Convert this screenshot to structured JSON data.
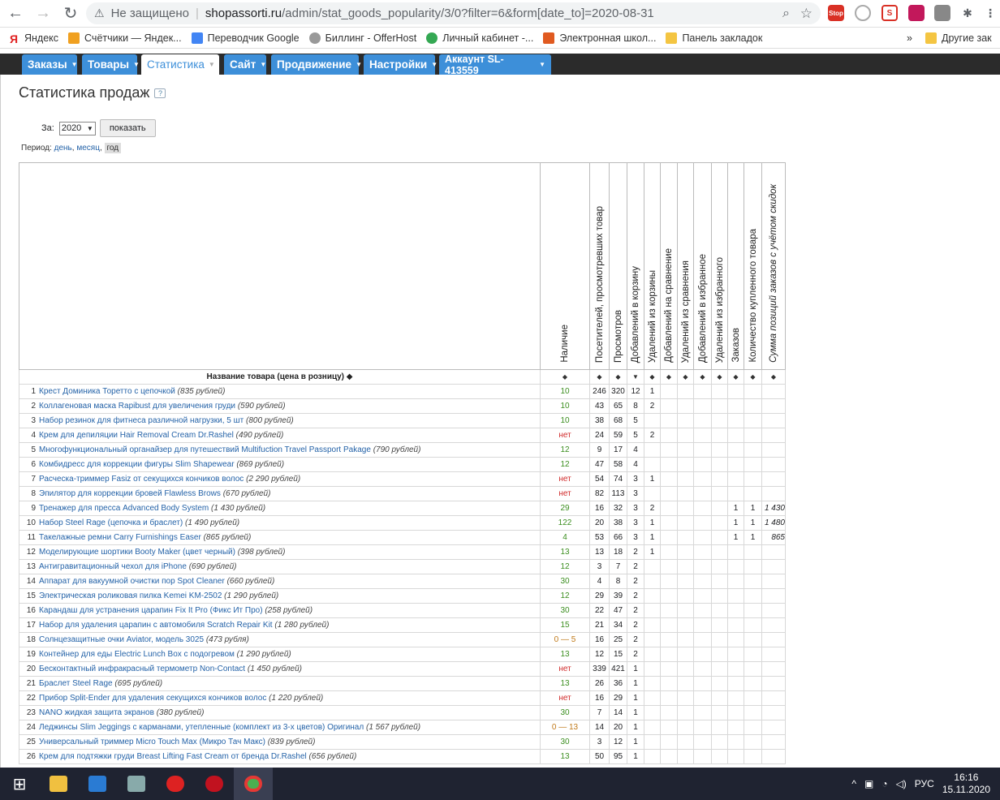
{
  "browser": {
    "security_text": "Не защищено",
    "url_host": "shopassorti.ru",
    "url_path": "/admin/stat_goods_popularity/3/0?filter=6&form[date_to]=2020-08-31"
  },
  "bookmarks": [
    {
      "label": "Яндекс",
      "color": "#e02020"
    },
    {
      "label": "Счётчики — Яндек...",
      "color": "#f0a020"
    },
    {
      "label": "Переводчик Google",
      "color": "#4285f4"
    },
    {
      "label": "Биллинг - OfferHost",
      "color": "#777777"
    },
    {
      "label": "Личный кабинет -...",
      "color": "#34a853"
    },
    {
      "label": "Электронная школ...",
      "color": "#e05a20"
    },
    {
      "label": "Панель закладок",
      "color": "#f4c542"
    }
  ],
  "bookmarks_other": "Другие зак",
  "admin_tabs": [
    "Заказы",
    "Товары",
    "Статистика",
    "Сайт",
    "Продвижение",
    "Настройки",
    "Аккаунт SL-413559"
  ],
  "page": {
    "title": "Статистика продаж",
    "help": "?",
    "for_label": "За:",
    "year": "2020",
    "show_button": "показать",
    "period_label": "Период:",
    "period_day": "день",
    "period_month": "месяц",
    "period_year": "год"
  },
  "table": {
    "name_header": "Название товара (цена в розницу) ◆",
    "columns": [
      "Наличие",
      "Посетителей, просмотревших товар",
      "Просмотров",
      "Добавлений в корзину",
      "Удалений из корзины",
      "Добавлений на сравнение",
      "Удалений из сравнения",
      "Добавлений в избранное",
      "Удалений из избранного",
      "Заказов",
      "Количество купленного товара",
      "Сумма позиций заказов с учётом скидок"
    ],
    "sort_marks": [
      "◆",
      "◆",
      "◆",
      "▼",
      "◆",
      "◆",
      "◆",
      "◆",
      "◆",
      "◆",
      "◆",
      "◆"
    ],
    "rows": [
      {
        "n": "1",
        "name": "Крест Доминика Торетто с цепочкой",
        "price": "(835 рублей)",
        "stock": "10",
        "st": "ok",
        "v": [
          "246",
          "320",
          "12",
          "1",
          "",
          "",
          "",
          "",
          "",
          "",
          ""
        ]
      },
      {
        "n": "2",
        "name": "Коллагеновая маска Rapibust для увеличения груди",
        "price": "(590 рублей)",
        "stock": "10",
        "st": "ok",
        "v": [
          "43",
          "65",
          "8",
          "2",
          "",
          "",
          "",
          "",
          "",
          "",
          ""
        ]
      },
      {
        "n": "3",
        "name": "Набор резинок для фитнеса различной нагрузки, 5 шт",
        "price": "(800 рублей)",
        "stock": "10",
        "st": "ok",
        "v": [
          "38",
          "68",
          "5",
          "",
          "",
          "",
          "",
          "",
          "",
          "",
          ""
        ]
      },
      {
        "n": "4",
        "name": "Крем для депиляции Hair Removal Cream Dr.Rashel",
        "price": "(490 рублей)",
        "stock": "нет",
        "st": "no",
        "v": [
          "24",
          "59",
          "5",
          "2",
          "",
          "",
          "",
          "",
          "",
          "",
          ""
        ]
      },
      {
        "n": "5",
        "name": "Многофункциональный органайзер для путешествий Multifuction Travel Passport Pakage",
        "price": "(790 рублей)",
        "stock": "12",
        "st": "ok",
        "v": [
          "9",
          "17",
          "4",
          "",
          "",
          "",
          "",
          "",
          "",
          "",
          ""
        ]
      },
      {
        "n": "6",
        "name": "Комбидресс для коррекции фигуры Slim Shapewear",
        "price": "(869 рублей)",
        "stock": "12",
        "st": "ok",
        "v": [
          "47",
          "58",
          "4",
          "",
          "",
          "",
          "",
          "",
          "",
          "",
          ""
        ]
      },
      {
        "n": "7",
        "name": "Расческа-триммер Fasiz от секущихся кончиков волос",
        "price": "(2 290 рублей)",
        "stock": "нет",
        "st": "no",
        "v": [
          "54",
          "74",
          "3",
          "1",
          "",
          "",
          "",
          "",
          "",
          "",
          ""
        ]
      },
      {
        "n": "8",
        "name": "Эпилятор для коррекции бровей Flawless Brows",
        "price": "(670 рублей)",
        "stock": "нет",
        "st": "no",
        "v": [
          "82",
          "113",
          "3",
          "",
          "",
          "",
          "",
          "",
          "",
          "",
          ""
        ]
      },
      {
        "n": "9",
        "name": "Тренажер для пресса Advanced Body System",
        "price": "(1 430 рублей)",
        "stock": "29",
        "st": "ok",
        "v": [
          "16",
          "32",
          "3",
          "2",
          "",
          "",
          "",
          "",
          "1",
          "1",
          "1 430"
        ]
      },
      {
        "n": "10",
        "name": "Набор Steel Rage (цепочка и браслет)",
        "price": "(1 490 рублей)",
        "stock": "122",
        "st": "ok",
        "v": [
          "20",
          "38",
          "3",
          "1",
          "",
          "",
          "",
          "",
          "1",
          "1",
          "1 480"
        ]
      },
      {
        "n": "11",
        "name": "Такелажные ремни Carry Furnishings Easer",
        "price": "(865 рублей)",
        "stock": "4",
        "st": "ok",
        "v": [
          "53",
          "66",
          "3",
          "1",
          "",
          "",
          "",
          "",
          "1",
          "1",
          "865"
        ]
      },
      {
        "n": "12",
        "name": "Моделирующие шортики Booty Maker (цвет черный)",
        "price": "(398 рублей)",
        "stock": "13",
        "st": "ok",
        "v": [
          "13",
          "18",
          "2",
          "1",
          "",
          "",
          "",
          "",
          "",
          "",
          ""
        ]
      },
      {
        "n": "13",
        "name": "Антигравитационный чехол для iPhone",
        "price": "(690 рублей)",
        "stock": "12",
        "st": "ok",
        "v": [
          "3",
          "7",
          "2",
          "",
          "",
          "",
          "",
          "",
          "",
          "",
          ""
        ]
      },
      {
        "n": "14",
        "name": "Аппарат для вакуумной очистки пор Spot Cleaner",
        "price": "(660 рублей)",
        "stock": "30",
        "st": "ok",
        "v": [
          "4",
          "8",
          "2",
          "",
          "",
          "",
          "",
          "",
          "",
          "",
          ""
        ]
      },
      {
        "n": "15",
        "name": "Электрическая роликовая пилка Kemei KM-2502",
        "price": "(1 290 рублей)",
        "stock": "12",
        "st": "ok",
        "v": [
          "29",
          "39",
          "2",
          "",
          "",
          "",
          "",
          "",
          "",
          "",
          ""
        ]
      },
      {
        "n": "16",
        "name": "Карандаш для устранения царапин Fix It Pro (Фикс Ит Про)",
        "price": "(258 рублей)",
        "stock": "30",
        "st": "ok",
        "v": [
          "22",
          "47",
          "2",
          "",
          "",
          "",
          "",
          "",
          "",
          "",
          ""
        ]
      },
      {
        "n": "17",
        "name": "Набор для удаления царапин с автомобиля Scratch Repair Kit",
        "price": "(1 280 рублей)",
        "stock": "15",
        "st": "ok",
        "v": [
          "21",
          "34",
          "2",
          "",
          "",
          "",
          "",
          "",
          "",
          "",
          ""
        ]
      },
      {
        "n": "18",
        "name": "Солнцезащитные очки Aviator, модель 3025",
        "price": "(473 рубля)",
        "stock": "0 — 5",
        "st": "rng",
        "v": [
          "16",
          "25",
          "2",
          "",
          "",
          "",
          "",
          "",
          "",
          "",
          ""
        ]
      },
      {
        "n": "19",
        "name": "Контейнер для еды Electric Lunch Box с подогревом",
        "price": "(1 290 рублей)",
        "stock": "13",
        "st": "ok",
        "v": [
          "12",
          "15",
          "2",
          "",
          "",
          "",
          "",
          "",
          "",
          "",
          ""
        ]
      },
      {
        "n": "20",
        "name": "Бесконтактный инфракрасный термометр Non-Contact",
        "price": "(1 450 рублей)",
        "stock": "нет",
        "st": "no",
        "v": [
          "339",
          "421",
          "1",
          "",
          "",
          "",
          "",
          "",
          "",
          "",
          ""
        ]
      },
      {
        "n": "21",
        "name": "Браслет Steel Rage",
        "price": "(695 рублей)",
        "stock": "13",
        "st": "ok",
        "v": [
          "26",
          "36",
          "1",
          "",
          "",
          "",
          "",
          "",
          "",
          "",
          ""
        ]
      },
      {
        "n": "22",
        "name": "Прибор Split-Ender для удаления секущихся кончиков волос",
        "price": "(1 220 рублей)",
        "stock": "нет",
        "st": "no",
        "v": [
          "16",
          "29",
          "1",
          "",
          "",
          "",
          "",
          "",
          "",
          "",
          ""
        ]
      },
      {
        "n": "23",
        "name": "NANO жидкая защита экранов",
        "price": "(380 рублей)",
        "stock": "30",
        "st": "ok",
        "v": [
          "7",
          "14",
          "1",
          "",
          "",
          "",
          "",
          "",
          "",
          "",
          ""
        ]
      },
      {
        "n": "24",
        "name": "Леджинсы Slim Jeggings с карманами, утепленные (комплект из 3-х цветов) Оригинал",
        "price": "(1 567 рублей)",
        "stock": "0 — 13",
        "st": "rng",
        "v": [
          "14",
          "20",
          "1",
          "",
          "",
          "",
          "",
          "",
          "",
          "",
          ""
        ]
      },
      {
        "n": "25",
        "name": "Универсальный триммер Micro Touch Max (Микро Тач Макс)",
        "price": "(839 рублей)",
        "stock": "30",
        "st": "ok",
        "v": [
          "3",
          "12",
          "1",
          "",
          "",
          "",
          "",
          "",
          "",
          "",
          ""
        ]
      },
      {
        "n": "26",
        "name": "Крем для подтяжки груди Breast Lifting Fast Cream от бренда Dr.Rashel",
        "price": "(656 рублей)",
        "stock": "13",
        "st": "ok",
        "v": [
          "50",
          "95",
          "1",
          "",
          "",
          "",
          "",
          "",
          "",
          "",
          ""
        ]
      }
    ]
  },
  "taskbar": {
    "lang": "РУС",
    "time": "16:16",
    "date": "15.11.2020"
  }
}
